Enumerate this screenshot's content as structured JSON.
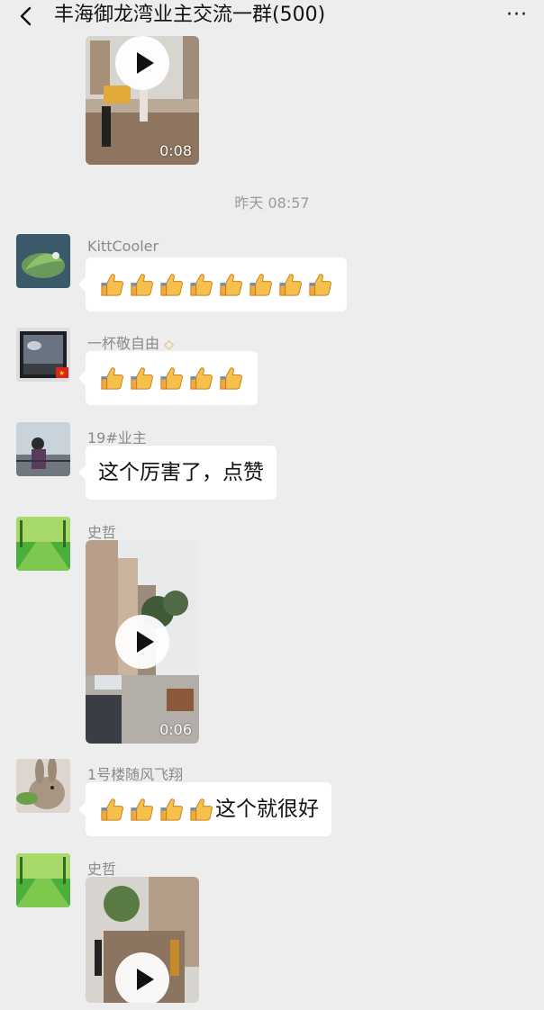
{
  "header": {
    "title": "丰海御龙湾业主交流一群(500)",
    "more_label": "···"
  },
  "messages": {
    "video_top": {
      "duration": "0:08"
    },
    "timestamp": "昨天 08:57",
    "m1": {
      "sender": "KittCooler",
      "thumbs_count": 8
    },
    "m2": {
      "sender": "一杯敬自由",
      "thumbs_count": 5
    },
    "m3": {
      "sender": "19#业主",
      "text": "这个厉害了，点赞"
    },
    "m4": {
      "sender": "史哲",
      "video_duration": "0:06"
    },
    "m5": {
      "sender": "1号楼随风飞翔",
      "thumbs_count": 4,
      "text": "这个就很好"
    },
    "m6": {
      "sender": "史哲"
    }
  },
  "colors": {
    "background": "#ededed",
    "bubble": "#ffffff",
    "meta_text": "#8a8a8a"
  },
  "icons": {
    "back": "chevron-left-icon",
    "more": "more-icon",
    "thumb": "thumbs-up-emoji",
    "play": "play-icon"
  }
}
